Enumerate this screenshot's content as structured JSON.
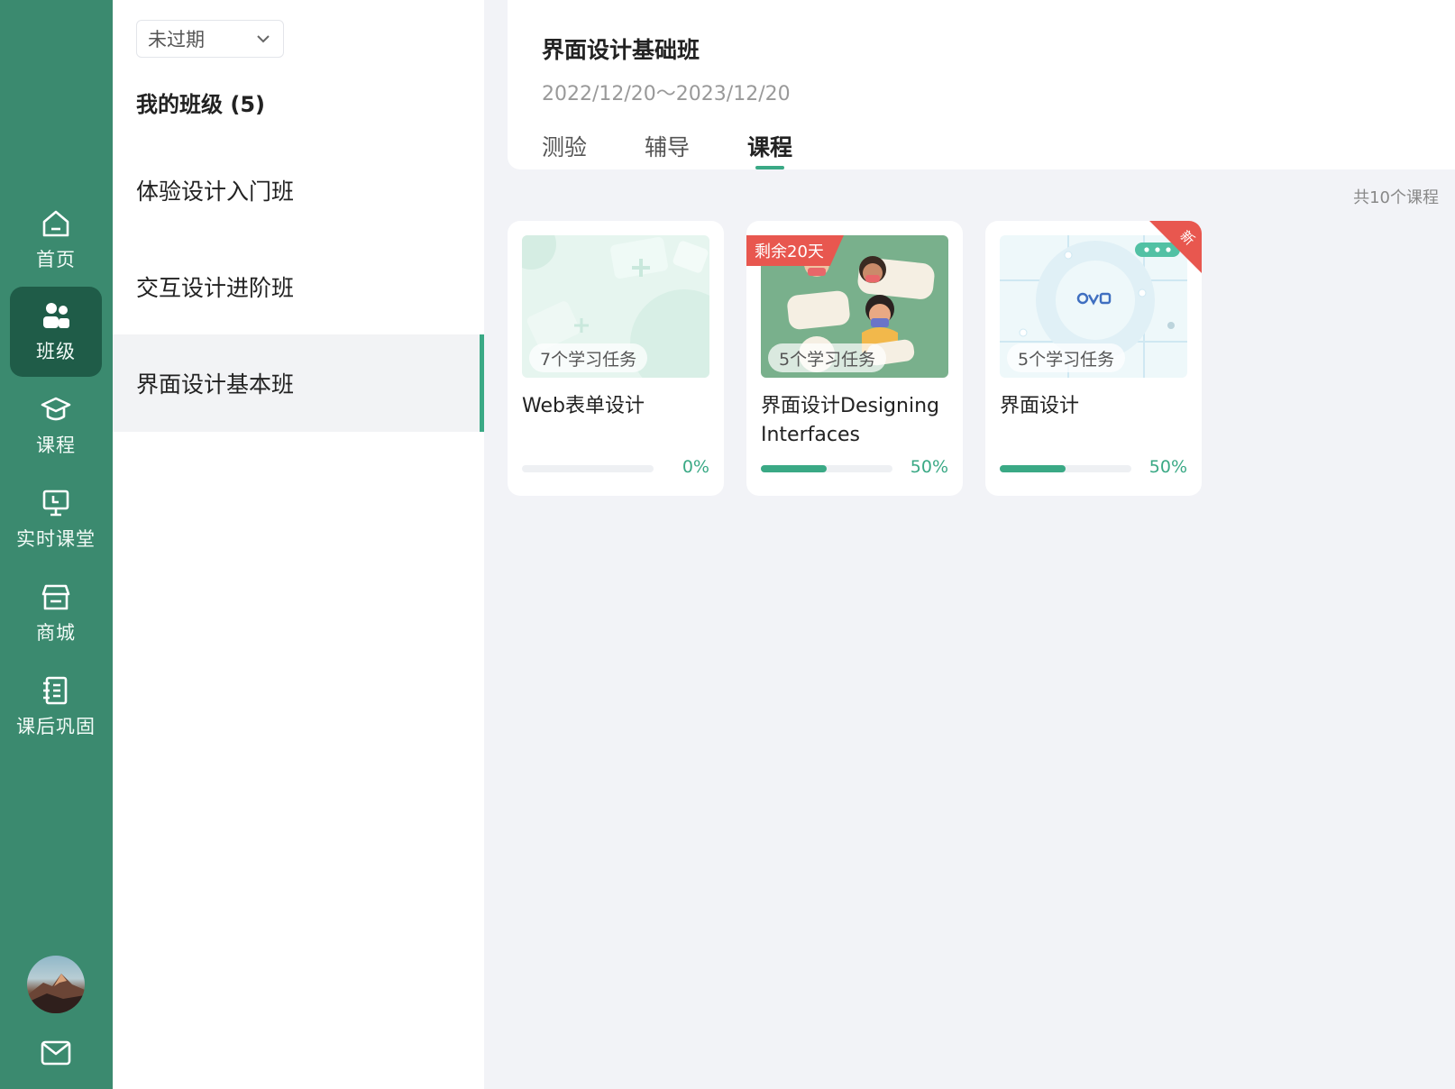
{
  "nav": {
    "items": [
      {
        "label": "首页",
        "icon": "home-icon"
      },
      {
        "label": "班级",
        "icon": "users-icon"
      },
      {
        "label": "课程",
        "icon": "graduation-cap-icon"
      },
      {
        "label": "实时课堂",
        "icon": "presentation-icon"
      },
      {
        "label": "商城",
        "icon": "store-icon"
      },
      {
        "label": "课后巩固",
        "icon": "notebook-icon"
      }
    ],
    "active_index": 1
  },
  "class_list": {
    "filter_value": "未过期",
    "heading": "我的班级 (5)",
    "items": [
      "体验设计入门班",
      "交互设计进阶班",
      "界面设计基本班"
    ],
    "active_index": 2
  },
  "class_detail": {
    "title": "界面设计基础班",
    "dates": "2022/12/20～2023/12/20",
    "tabs": [
      "测验",
      "辅导",
      "课程"
    ],
    "active_tab": 2,
    "total_count": "共10个课程"
  },
  "courses": [
    {
      "name": "Web表单设计",
      "tasks": "7个学习任务",
      "progress": 0,
      "progress_label": "0%"
    },
    {
      "name": "界面设计Designing Interfaces",
      "tasks": "5个学习任务",
      "progress": 50,
      "progress_label": "50%",
      "badge": "剩余20天"
    },
    {
      "name": "界面设计",
      "tasks": "5个学习任务",
      "progress": 50,
      "progress_label": "50%",
      "corner_tag": "新"
    }
  ],
  "colors": {
    "rail": "#3b8a6f",
    "rail_active": "#1f5c48",
    "accent": "#3aa985",
    "badge_red": "#e8574f"
  }
}
